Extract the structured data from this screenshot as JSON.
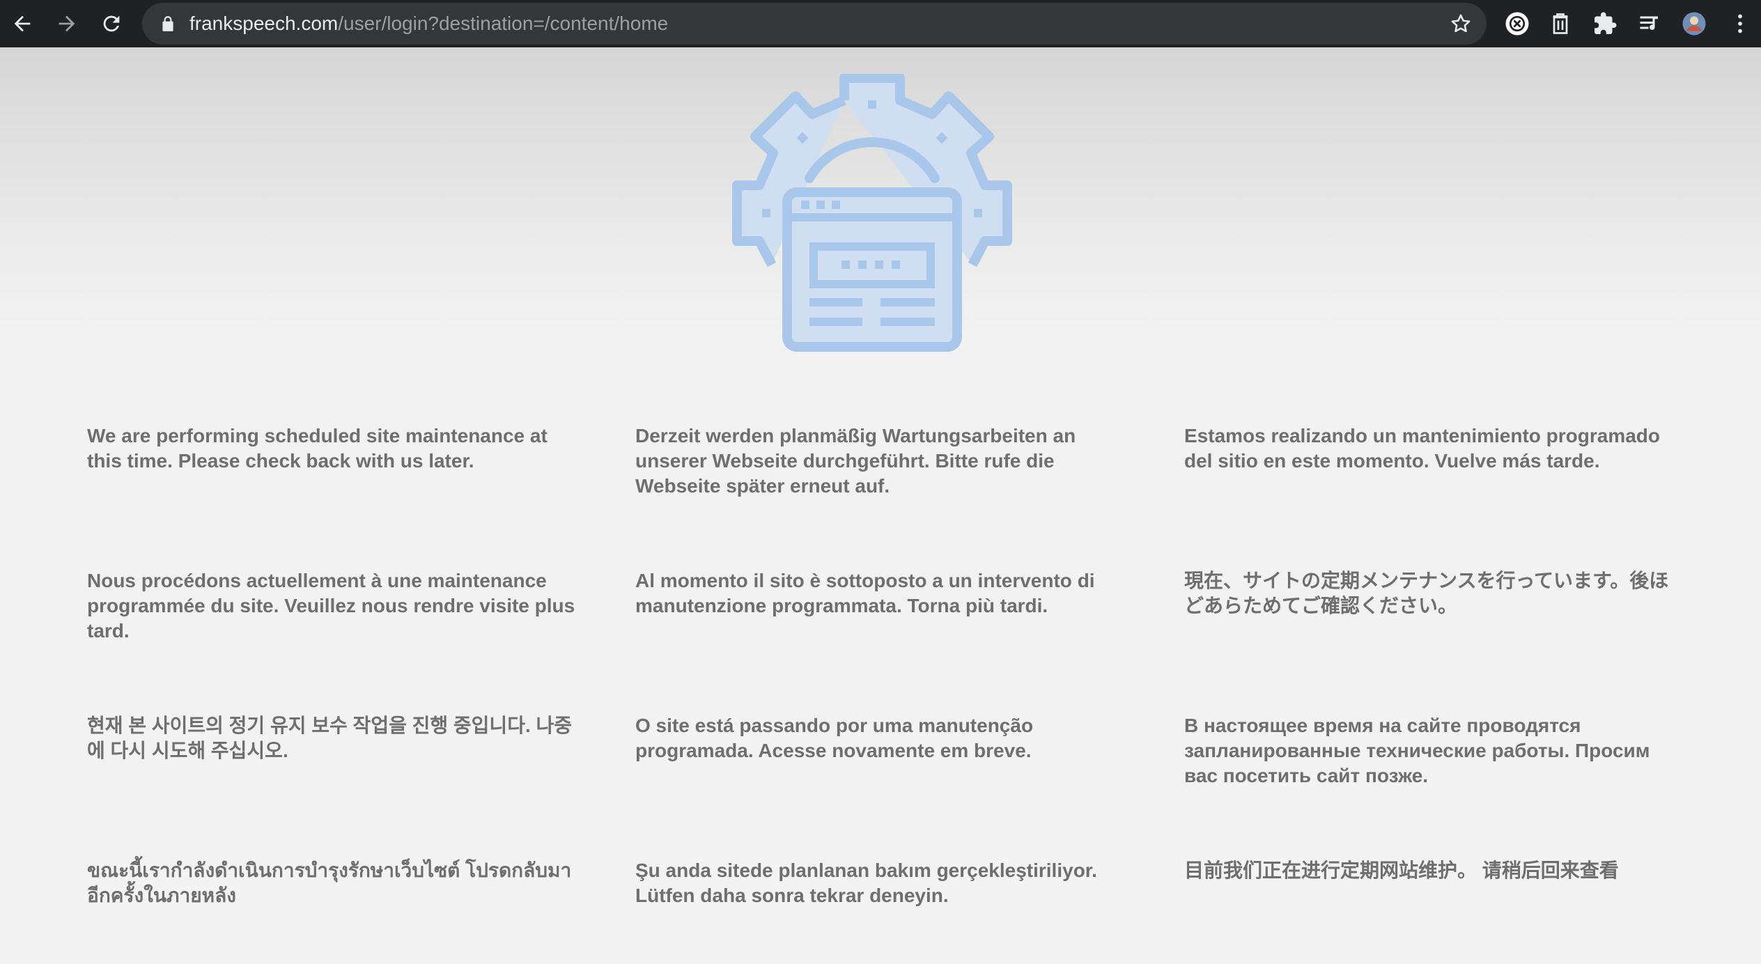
{
  "browser": {
    "url_host": "frankspeech.com",
    "url_path": "/user/login?destination=/content/home"
  },
  "colors": {
    "chrome_bg": "#202124",
    "omnibox_bg": "#35363a",
    "icon_blue": "#a9c7ea",
    "icon_fill": "#d0def1",
    "text_gray": "#6e6e6e"
  },
  "messages": {
    "en": "We are performing scheduled site maintenance at this time. Please check back with us later.",
    "de": "Derzeit werden planmäßig Wartungsarbeiten an unserer Webseite durchgeführt. Bitte rufe die Webseite später erneut auf.",
    "es": "Estamos realizando un mantenimiento programado del sitio en este momento. Vuelve más tarde.",
    "fr": "Nous procédons actuellement à une maintenance programmée du site. Veuillez nous rendre visite plus tard.",
    "it": "Al momento il sito è sottoposto a un intervento di manutenzione programmata. Torna più tardi.",
    "ja": "現在、サイトの定期メンテナンスを行っています。後ほどあらためてご確認ください。",
    "ko": "현재 본 사이트의 정기 유지 보수 작업을 진행 중입니다. 나중에 다시 시도해 주십시오.",
    "pt": "O site está passando por uma manutenção programada. Acesse novamente em breve.",
    "ru": "В настоящее время на сайте проводятся запланированные технические работы. Просим вас посетить сайт позже.",
    "th": "ขณะนี้เรากำลังดำเนินการบำรุงรักษาเว็บไซต์ โปรดกลับมาอีกครั้งในภายหลัง",
    "tr": "Şu anda sitede planlanan bakım gerçekleştiriliyor. Lütfen daha sonra tekrar deneyin.",
    "zh": "目前我们正在进行定期网站维护。 请稍后回来查看"
  }
}
